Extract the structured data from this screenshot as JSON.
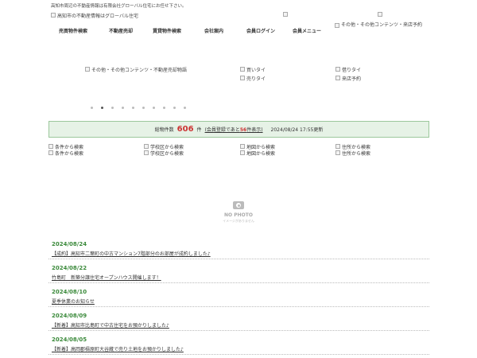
{
  "header": {
    "tagline": "高知市周辺の不動産情報は有限会社グローバル住宅にお任せ下さい。",
    "logo_alt": "高知市の不動産情報はグローバル住宅",
    "side_banner_alt": "その他・その他コンテンツ・来店予約"
  },
  "nav": {
    "items": [
      {
        "label": "売買物件検索"
      },
      {
        "label": "不動産売却"
      },
      {
        "label": "賃貸物件検索"
      },
      {
        "label": "会社案内"
      },
      {
        "label": "会員ログイン"
      },
      {
        "label": "会員メニュー"
      }
    ]
  },
  "banners": {
    "main_alt": "その他・その他コンテンツ・不動産売却物語",
    "buy": "買いタイ",
    "sell": "売りタイ",
    "rent": "借りタイ",
    "visit": "来店予約"
  },
  "slider": {
    "dot_count": 10,
    "active_index": 1
  },
  "count_bar": {
    "prefix": "総物件数",
    "total": "606",
    "unit": "件",
    "link_pre": "(会員登録であと",
    "link_num": "56",
    "link_post": "件表示)",
    "updated": "2024/08/24 17:55更新"
  },
  "search": {
    "cells": [
      {
        "label_a": "条件から検索",
        "label_b": "条件から検索"
      },
      {
        "label_a": "学校区から検索",
        "label_b": "学校区から検索"
      },
      {
        "label_a": "地図から検索",
        "label_b": "地図から検索"
      },
      {
        "label_a": "住所から検索",
        "label_b": "住所から検索"
      }
    ]
  },
  "noimage": {
    "title": "NO PHOTO",
    "sub": "イメージがありません"
  },
  "news": [
    {
      "date": "2024/08/24",
      "title": "【成約】高知市二葉町の中古マンション7階部分のお部屋が成約しました♪"
    },
    {
      "date": "2024/08/22",
      "title": "竹島町　新築分譲住宅オープンハウス開催します！"
    },
    {
      "date": "2024/08/10",
      "title": "夏季休業のお知らせ"
    },
    {
      "date": "2024/08/09",
      "title": "【新着】高知市比島町で中古住宅をお預かりしました♪"
    },
    {
      "date": "2024/08/05",
      "title": "【新着】高岡郡檮原町大谷蔵で売り土地をお預かりしました♪"
    }
  ]
}
